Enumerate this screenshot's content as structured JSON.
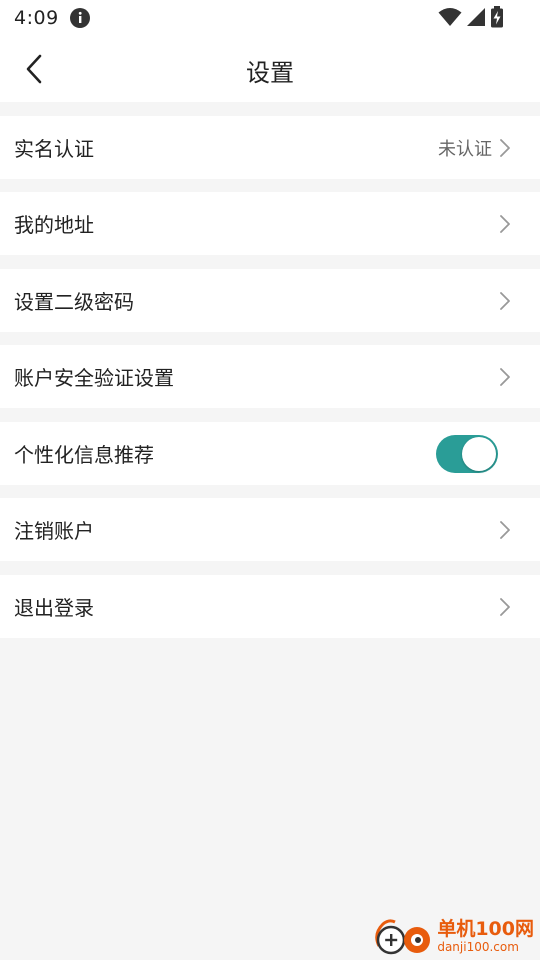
{
  "status_bar": {
    "time": "4:09"
  },
  "header": {
    "title": "设置"
  },
  "settings": {
    "items": [
      {
        "label": "实名认证",
        "value": "未认证"
      },
      {
        "label": "我的地址"
      },
      {
        "label": "设置二级密码"
      },
      {
        "label": "账户安全验证设置"
      },
      {
        "label": "个性化信息推荐",
        "toggle_on": true
      },
      {
        "label": "注销账户"
      },
      {
        "label": "退出登录"
      }
    ]
  },
  "watermark": {
    "title": "单机100网",
    "url": "danji100.com"
  },
  "colors": {
    "toggle_on": "#2a9d97",
    "background": "#f5f5f5",
    "watermark": "#e85c0d"
  }
}
